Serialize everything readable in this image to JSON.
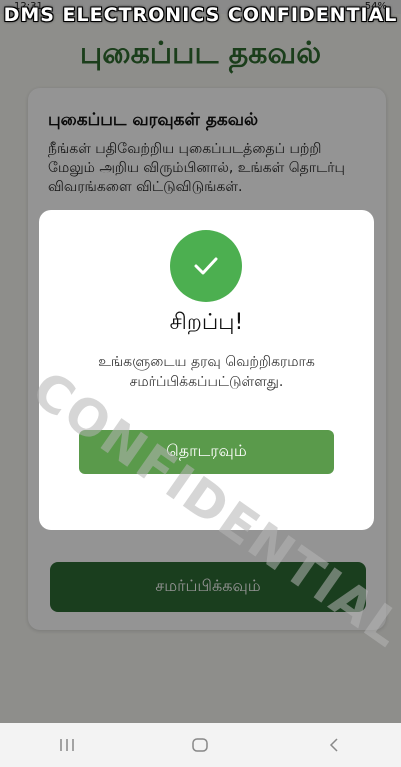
{
  "status_bar": {
    "time": "12:31",
    "battery": "54%"
  },
  "banner": "DMS ELECTRONICS CONFIDENTIAL",
  "page": {
    "title": "புகைப்பட தகவல்"
  },
  "card": {
    "heading": "புகைப்பட வரவுகள் தகவல்",
    "description": "நீங்கள் பதிவேற்றிய புகைப்படத்தைப் பற்றி மேலும் அறிய விரும்பினால், உங்கள் தொடர்பு விவரங்களை விட்டுவிடுங்கள்.",
    "submit_label": "சமர்ப்பிக்கவும்"
  },
  "dialog": {
    "title": "சிறப்பு!",
    "message": "உங்களுடைய தரவு வெற்றிகரமாக சமர்ப்பிக்கப்பட்டுள்ளது.",
    "continue_label": "தொடரவும்",
    "icon": "check-icon"
  },
  "watermark": "CONFIDENTIAL",
  "nav": {
    "icons": [
      "recent-apps-icon",
      "home-icon",
      "back-icon"
    ]
  },
  "colors": {
    "primary": "#2e6b35",
    "success": "#4caf50",
    "continue": "#5a9a4b",
    "title": "#2f6b2f"
  }
}
